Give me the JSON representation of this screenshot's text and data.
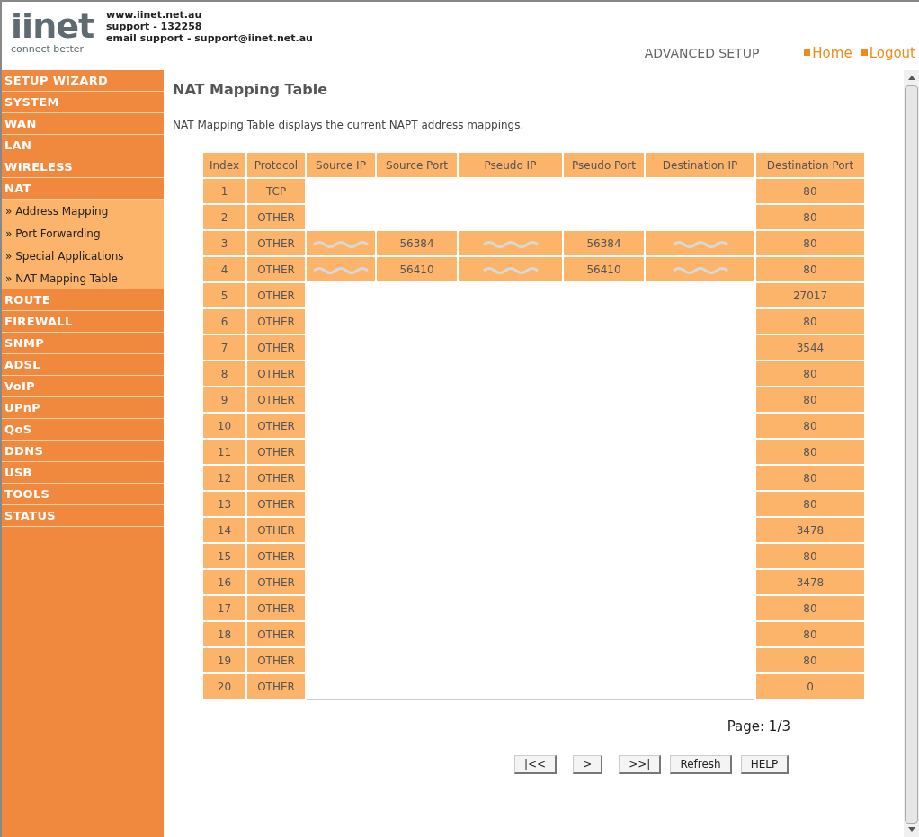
{
  "header": {
    "logo_word": "iinet",
    "logo_tagline": "connect better",
    "contact_lines": [
      "www.iinet.net.au",
      "support - 132258",
      "email support - support@iinet.net.au"
    ],
    "section": "ADVANCED SETUP",
    "links": [
      {
        "label": "Home"
      },
      {
        "label": "Logout"
      }
    ]
  },
  "sidebar": {
    "items": [
      {
        "label": "SETUP WIZARD",
        "kind": "main"
      },
      {
        "label": "SYSTEM",
        "kind": "main"
      },
      {
        "label": "WAN",
        "kind": "main"
      },
      {
        "label": "LAN",
        "kind": "main"
      },
      {
        "label": "WIRELESS",
        "kind": "main"
      },
      {
        "label": "NAT",
        "kind": "main"
      },
      {
        "label": "» Address Mapping",
        "kind": "sub"
      },
      {
        "label": "» Port Forwarding",
        "kind": "sub"
      },
      {
        "label": "» Special Applications",
        "kind": "sub"
      },
      {
        "label": "» NAT Mapping Table",
        "kind": "sub"
      },
      {
        "label": "ROUTE",
        "kind": "main"
      },
      {
        "label": "FIREWALL",
        "kind": "main"
      },
      {
        "label": "SNMP",
        "kind": "main"
      },
      {
        "label": "ADSL",
        "kind": "main"
      },
      {
        "label": "VoIP",
        "kind": "main"
      },
      {
        "label": "UPnP",
        "kind": "main"
      },
      {
        "label": "QoS",
        "kind": "main"
      },
      {
        "label": "DDNS",
        "kind": "main"
      },
      {
        "label": "USB",
        "kind": "main"
      },
      {
        "label": "TOOLS",
        "kind": "main"
      },
      {
        "label": "STATUS",
        "kind": "main"
      }
    ]
  },
  "page": {
    "title": "NAT Mapping Table",
    "description": "NAT Mapping Table displays the current NAPT address mappings."
  },
  "table": {
    "columns": [
      "Index",
      "Protocol",
      "Source IP",
      "Source Port",
      "Pseudo IP",
      "Pseudo Port",
      "Destination IP",
      "Destination Port"
    ],
    "rows": [
      {
        "index": "1",
        "protocol": "TCP",
        "redacted": true,
        "destination_port": "80"
      },
      {
        "index": "2",
        "protocol": "OTHER",
        "redacted": true,
        "destination_port": "80"
      },
      {
        "index": "3",
        "protocol": "OTHER",
        "redacted": false,
        "source_port": "56384",
        "pseudo_port": "56384",
        "destination_port": "80"
      },
      {
        "index": "4",
        "protocol": "OTHER",
        "redacted": false,
        "source_port": "56410",
        "pseudo_port": "56410",
        "destination_port": "80"
      },
      {
        "index": "5",
        "protocol": "OTHER",
        "redacted": true,
        "destination_port": "27017"
      },
      {
        "index": "6",
        "protocol": "OTHER",
        "redacted": true,
        "destination_port": "80"
      },
      {
        "index": "7",
        "protocol": "OTHER",
        "redacted": true,
        "destination_port": "3544"
      },
      {
        "index": "8",
        "protocol": "OTHER",
        "redacted": true,
        "destination_port": "80"
      },
      {
        "index": "9",
        "protocol": "OTHER",
        "redacted": true,
        "destination_port": "80"
      },
      {
        "index": "10",
        "protocol": "OTHER",
        "redacted": true,
        "destination_port": "80"
      },
      {
        "index": "11",
        "protocol": "OTHER",
        "redacted": true,
        "destination_port": "80"
      },
      {
        "index": "12",
        "protocol": "OTHER",
        "redacted": true,
        "destination_port": "80"
      },
      {
        "index": "13",
        "protocol": "OTHER",
        "redacted": true,
        "destination_port": "80"
      },
      {
        "index": "14",
        "protocol": "OTHER",
        "redacted": true,
        "destination_port": "3478"
      },
      {
        "index": "15",
        "protocol": "OTHER",
        "redacted": true,
        "destination_port": "80"
      },
      {
        "index": "16",
        "protocol": "OTHER",
        "redacted": true,
        "destination_port": "3478"
      },
      {
        "index": "17",
        "protocol": "OTHER",
        "redacted": true,
        "destination_port": "80"
      },
      {
        "index": "18",
        "protocol": "OTHER",
        "redacted": true,
        "destination_port": "80"
      },
      {
        "index": "19",
        "protocol": "OTHER",
        "redacted": true,
        "destination_port": "80"
      },
      {
        "index": "20",
        "protocol": "OTHER",
        "redacted": true,
        "destination_port": "0"
      }
    ]
  },
  "pagination": {
    "label": "Page: 1/3"
  },
  "buttons": [
    "|<<",
    ">",
    ">>|",
    "Refresh",
    "HELP"
  ]
}
